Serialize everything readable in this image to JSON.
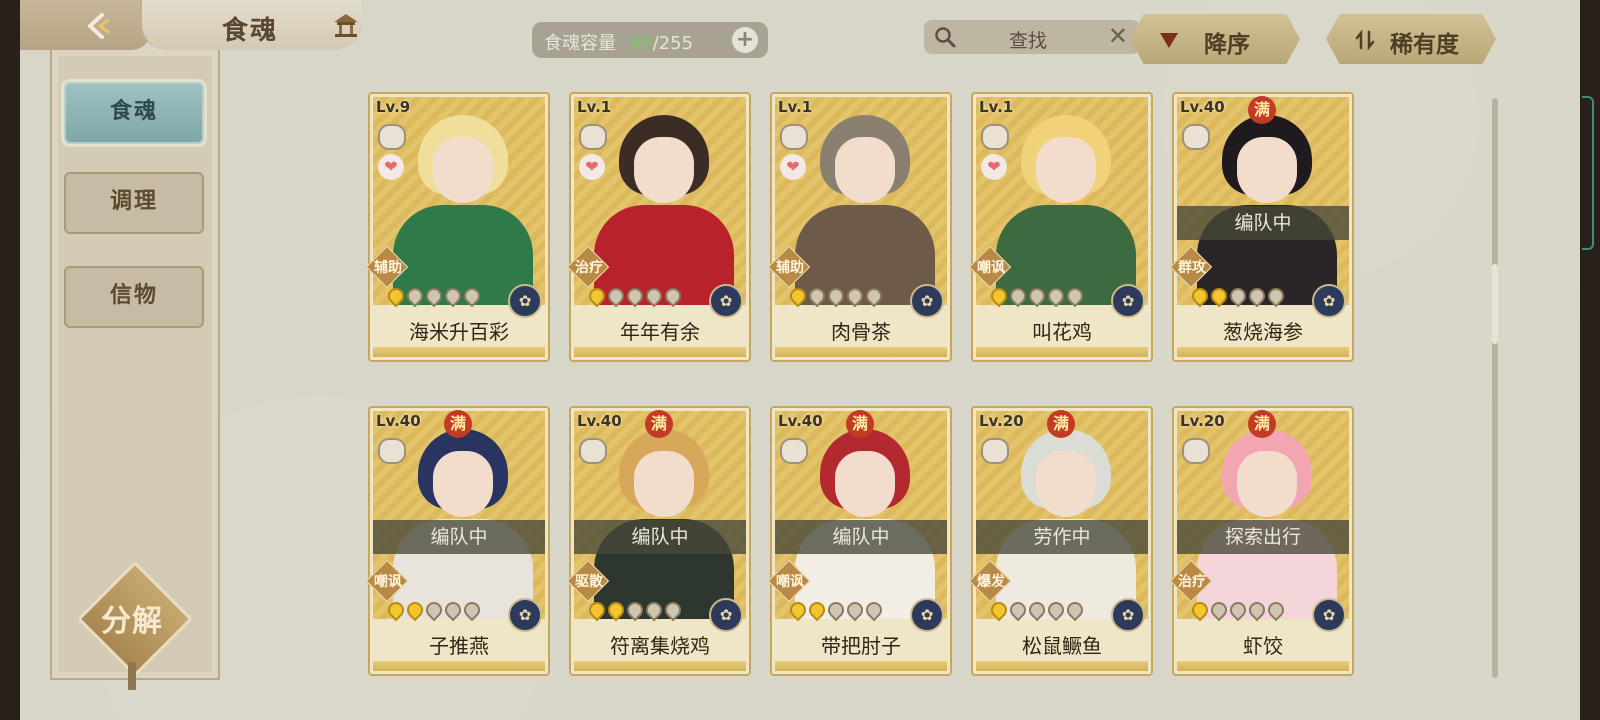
{
  "header": {
    "title": "食魂",
    "capacity_label": "食魂容量",
    "capacity_current": "66",
    "capacity_max": "/255",
    "capacity_add": "+",
    "search_placeholder": "查找",
    "search_clear": "✕",
    "sort_order_label": "降序",
    "sort_key_label": "稀有度"
  },
  "sidebar": {
    "items": [
      {
        "label": "食魂",
        "active": true
      },
      {
        "label": "调理",
        "active": false
      },
      {
        "label": "信物",
        "active": false
      }
    ],
    "decompose_label": "分解"
  },
  "colors": {
    "accent_gold": "#c8a65c",
    "active_tab": "#8fb3b4",
    "capacity_current": "#7dc36a",
    "max_badge": "#c33a25"
  },
  "cards": [
    {
      "level": "Lv.9",
      "max": "",
      "role": "辅助",
      "name": "海米升百彩",
      "status": "",
      "heart": true,
      "flames_on": 1,
      "hair": "#f0df9a",
      "body": "#2f7a4a"
    },
    {
      "level": "Lv.1",
      "max": "",
      "role": "治疗",
      "name": "年年有余",
      "status": "",
      "heart": true,
      "flames_on": 1,
      "hair": "#3b2c26",
      "body": "#b8222a"
    },
    {
      "level": "Lv.1",
      "max": "",
      "role": "辅助",
      "name": "肉骨茶",
      "status": "",
      "heart": true,
      "flames_on": 1,
      "hair": "#8a8070",
      "body": "#6d5a48"
    },
    {
      "level": "Lv.1",
      "max": "",
      "role": "嘲讽",
      "name": "叫花鸡",
      "status": "",
      "heart": true,
      "flames_on": 1,
      "hair": "#f0d27a",
      "body": "#3e6a40"
    },
    {
      "level": "Lv.40",
      "max": "满",
      "role": "群攻",
      "name": "葱烧海参",
      "status": "编队中",
      "heart": false,
      "flames_on": 2,
      "hair": "#1e1a1e",
      "body": "#2a2628"
    },
    {
      "level": "Lv.40",
      "max": "满",
      "role": "嘲讽",
      "name": "子推燕",
      "status": "编队中",
      "heart": false,
      "flames_on": 2,
      "hair": "#2a3460",
      "body": "#e8e4dc"
    },
    {
      "level": "Lv.40",
      "max": "满",
      "role": "驱散",
      "name": "符离集烧鸡",
      "status": "编队中",
      "heart": false,
      "flames_on": 2,
      "hair": "#d8a85a",
      "body": "#2e3630"
    },
    {
      "level": "Lv.40",
      "max": "满",
      "role": "嘲讽",
      "name": "带把肘子",
      "status": "编队中",
      "heart": false,
      "flames_on": 2,
      "hair": "#b22a30",
      "body": "#f2eee6"
    },
    {
      "level": "Lv.20",
      "max": "满",
      "role": "爆发",
      "name": "松鼠鳜鱼",
      "status": "劳作中",
      "heart": false,
      "flames_on": 1,
      "hair": "#dcdcd6",
      "body": "#eeeae0"
    },
    {
      "level": "Lv.20",
      "max": "满",
      "role": "治疗",
      "name": "虾饺",
      "status": "探索出行",
      "heart": false,
      "flames_on": 1,
      "hair": "#f2a6b2",
      "body": "#f4d6da"
    }
  ]
}
